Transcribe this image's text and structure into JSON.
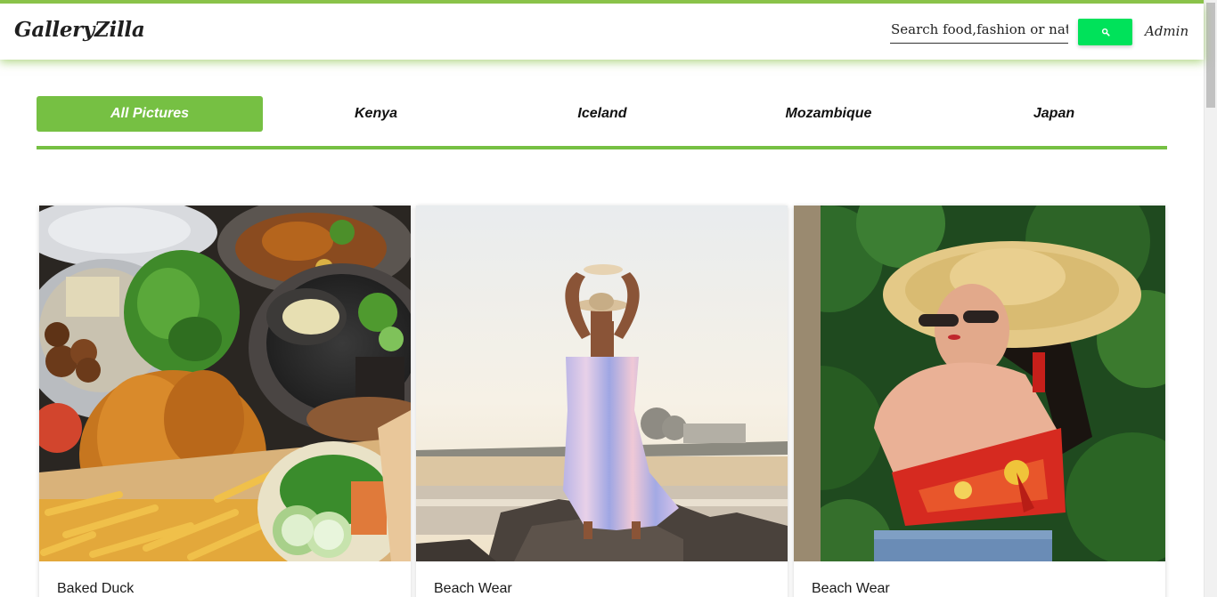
{
  "app": {
    "brand": "GalleryZilla",
    "accent_color": "#76c043",
    "search_button_color": "#00e25a"
  },
  "header": {
    "search": {
      "value": "",
      "placeholder": "Search food,fashion or nature",
      "button_icon": "search-icon"
    },
    "admin_label": "Admin"
  },
  "tabs": [
    {
      "label": "All Pictures",
      "active": true
    },
    {
      "label": "Kenya",
      "active": false
    },
    {
      "label": "Iceland",
      "active": false
    },
    {
      "label": "Mozambique",
      "active": false
    },
    {
      "label": "Japan",
      "active": false
    }
  ],
  "gallery": [
    {
      "title": "Baked Duck",
      "image": "food-plate-photo"
    },
    {
      "title": "Beach Wear",
      "image": "woman-beach-dress-photo"
    },
    {
      "title": "Beach Wear",
      "image": "woman-sun-hat-photo"
    }
  ]
}
